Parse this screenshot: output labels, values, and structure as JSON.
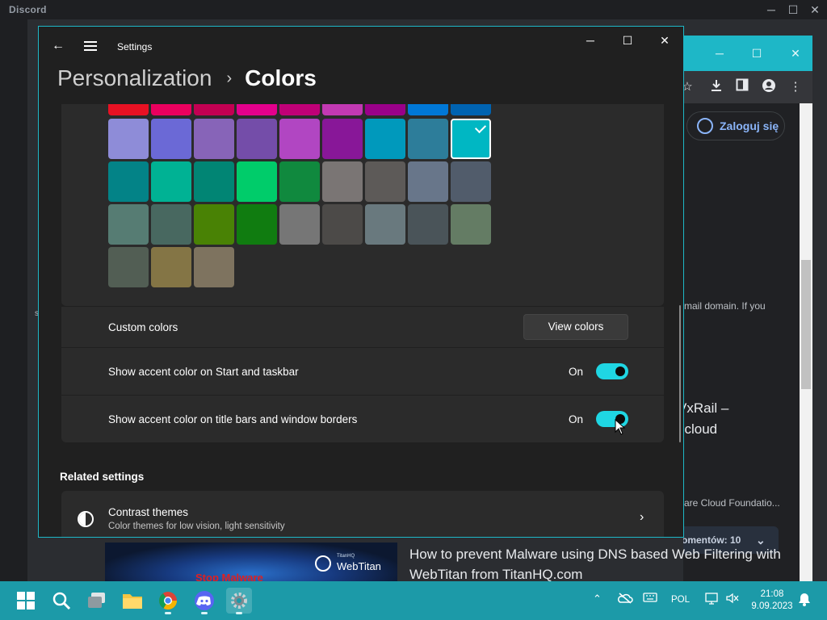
{
  "discord": {
    "title": "Discord",
    "stray_char": "s"
  },
  "browser": {
    "login_label": "Zaloguj się",
    "text_email": "mail domain. If you",
    "text_vxrail_1": "VxRail –",
    "text_vxrail_2": "l cloud",
    "text_vcf": "are Cloud Foundatio...",
    "comments_label": "omentów: 10",
    "article_headline": "How to prevent Malware using DNS based Web Filtering with WebTitan from TitanHQ.com",
    "thumb_logo_small": "TitanHQ",
    "thumb_logo_big": "WebTitan",
    "thumb_red_text": "Stop Malware"
  },
  "settings": {
    "window_title": "Settings",
    "breadcrumb_parent": "Personalization",
    "breadcrumb_separator": "›",
    "breadcrumb_current": "Colors",
    "palette_partial_row": [
      "#e81123",
      "#ea005e",
      "#c30052",
      "#e3008c",
      "#bf0077",
      "#c239b3",
      "#9a0089",
      "#0078d7",
      "#0063b1"
    ],
    "palette_rows": [
      [
        "#8e8cd8",
        "#6b69d6",
        "#8764b8",
        "#744da9",
        "#b146c2",
        "#881798",
        "#0099bc",
        "#2d7d9a",
        "#00b7c3"
      ],
      [
        "#038387",
        "#00b294",
        "#018574",
        "#00cc6a",
        "#10893e",
        "#7a7574",
        "#5d5a58",
        "#68768a",
        "#515c6b"
      ],
      [
        "#567c73",
        "#486860",
        "#498205",
        "#107c10",
        "#767676",
        "#4c4a48",
        "#69797e",
        "#4a5459",
        "#647c64"
      ],
      [
        "#525e54",
        "#847545",
        "#7e735f"
      ]
    ],
    "selected_color": "#00b7c3",
    "custom_colors_label": "Custom colors",
    "view_colors_button": "View colors",
    "accent_start_label": "Show accent color on Start and taskbar",
    "accent_start_state": "On",
    "accent_titlebar_label": "Show accent color on title bars and window borders",
    "accent_titlebar_state": "On",
    "related_header": "Related settings",
    "contrast_title": "Contrast themes",
    "contrast_subtitle": "Color themes for low vision, light sensitivity",
    "accent_color": "#1fd6e3"
  },
  "taskbar": {
    "language": "POL",
    "time": "21:08",
    "date": "9.09.2023",
    "icons": [
      "start-icon",
      "search-icon",
      "task-view-icon",
      "file-explorer-icon",
      "chrome-icon",
      "discord-icon",
      "settings-icon"
    ]
  }
}
